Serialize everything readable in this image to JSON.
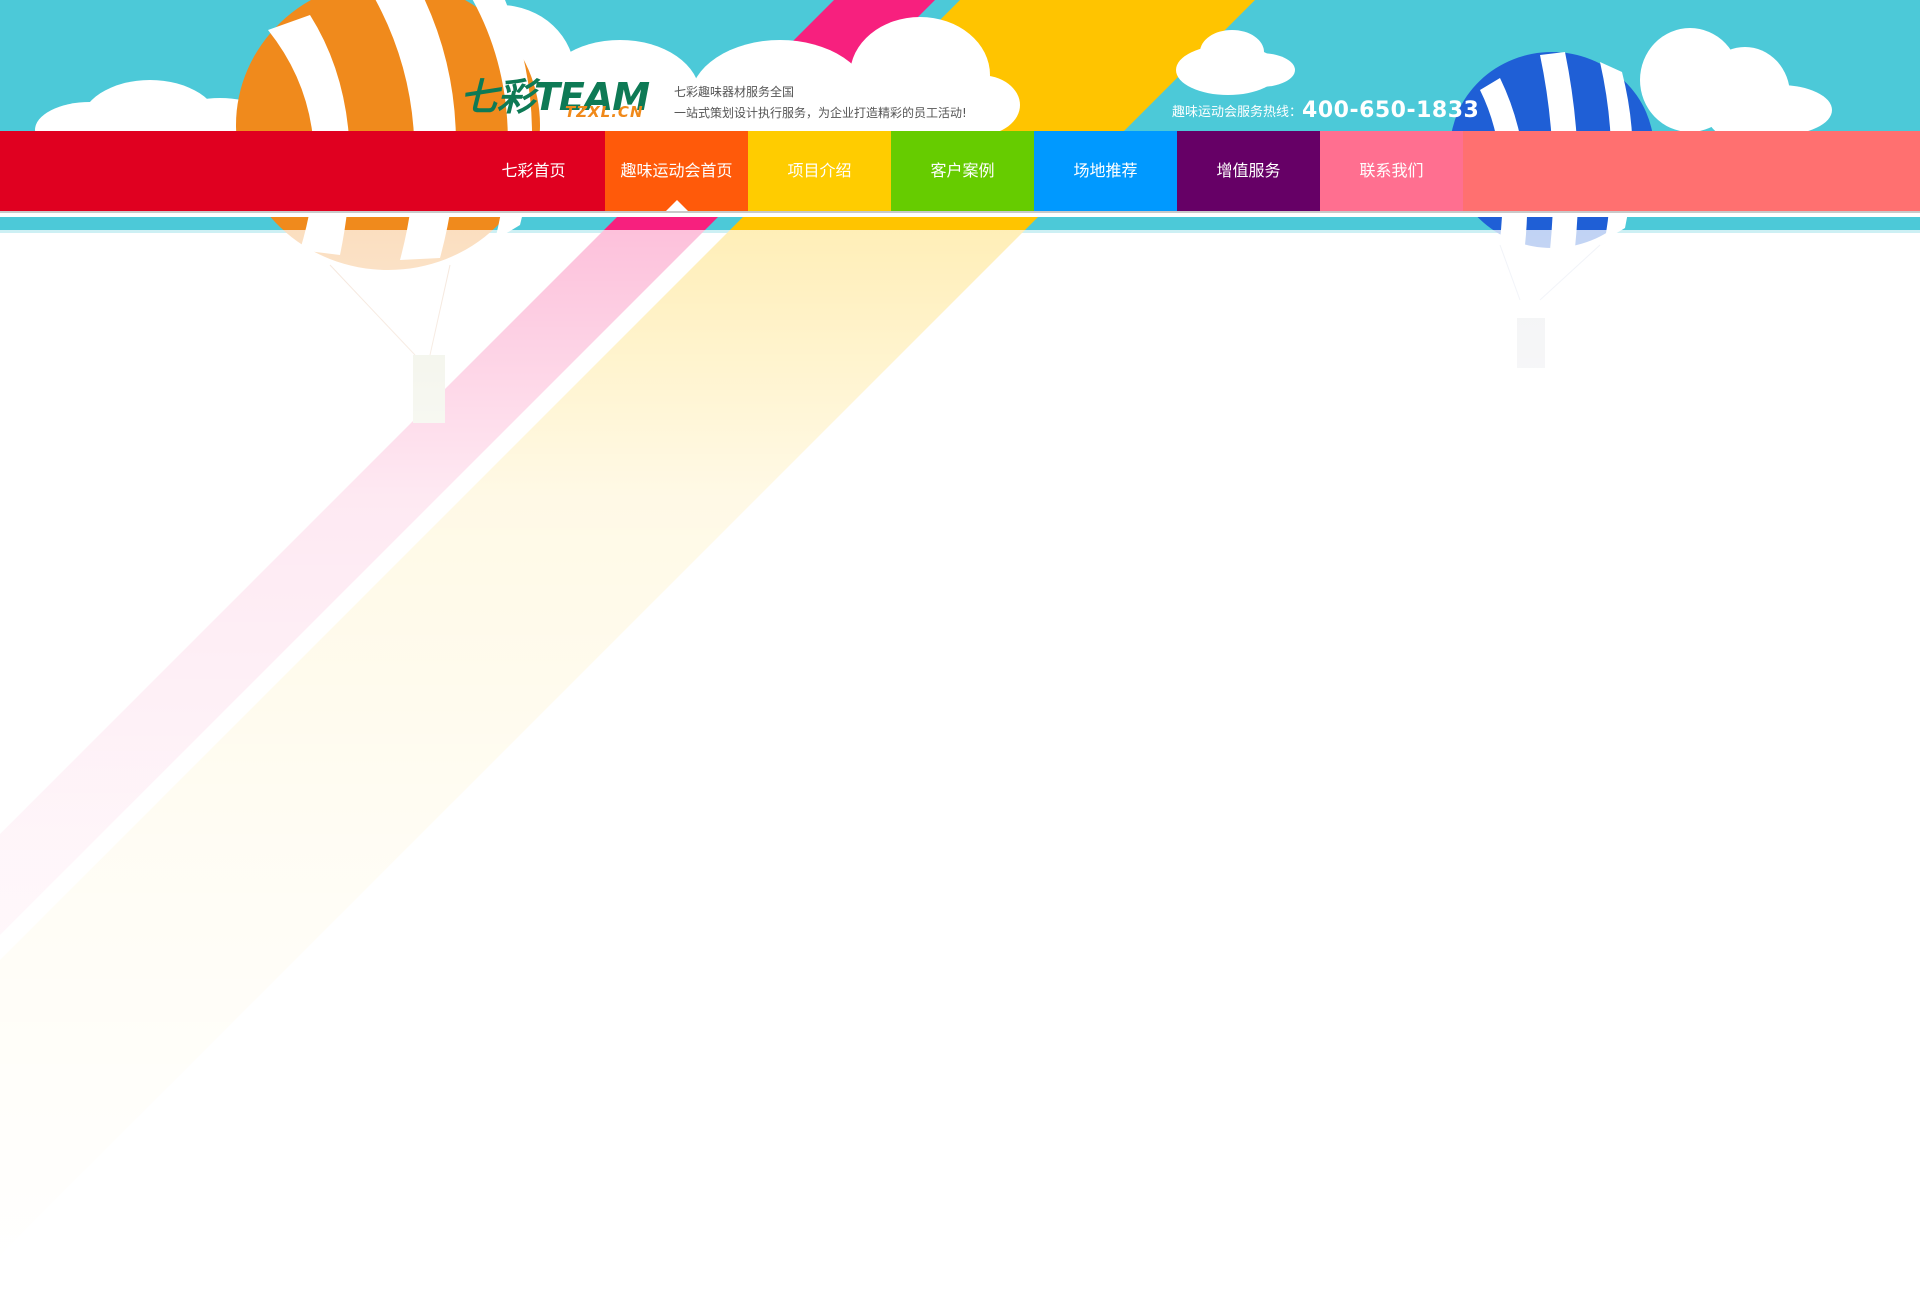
{
  "header": {
    "logo": {
      "main": "七彩TEAM",
      "sub": "TZXL.CN"
    },
    "slogan": {
      "line1": "七彩趣味器材服务全国",
      "line2": "一站式策划设计执行服务，为企业打造精彩的员工活动!"
    },
    "hotline": {
      "label": "趣味运动会服务热线：",
      "number": "400-650-1833"
    }
  },
  "nav": {
    "items": [
      {
        "label": "七彩首页",
        "color": "#e00020",
        "active": false
      },
      {
        "label": "趣味运动会首页",
        "color": "#ff5a0a",
        "active": true
      },
      {
        "label": "项目介绍",
        "color": "#ffcc00",
        "active": false
      },
      {
        "label": "客户案例",
        "color": "#66cc00",
        "active": false
      },
      {
        "label": "场地推荐",
        "color": "#0099ff",
        "active": false
      },
      {
        "label": "增值服务",
        "color": "#660066",
        "active": false
      },
      {
        "label": "联系我们",
        "color": "#ff6f90",
        "active": false
      }
    ]
  },
  "colors": {
    "sky": "#4cc9d8",
    "nav_left": "#e00020",
    "nav_right": "#ff7070",
    "logo_green": "#0e7a55",
    "logo_orange": "#f0891a"
  }
}
